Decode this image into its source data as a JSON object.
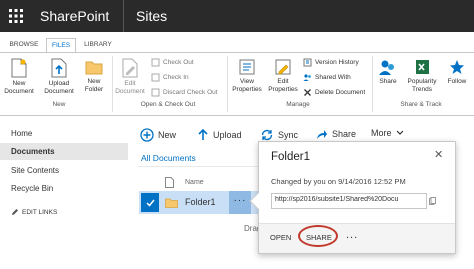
{
  "suite_bar": {
    "brand": "SharePoint",
    "site_link": "Sites",
    "bg_color": "#2a2a2a"
  },
  "ribbon": {
    "tabs": [
      {
        "label": "BROWSE",
        "selected": false
      },
      {
        "label": "FILES",
        "selected": true
      },
      {
        "label": "LIBRARY",
        "selected": false
      }
    ],
    "groups": {
      "new": {
        "label": "New",
        "new_document": "New Document",
        "upload_document": "Upload Document",
        "new_folder": "New Folder"
      },
      "open_checkout": {
        "label": "Open & Check Out",
        "edit_document": "Edit Document",
        "check_out": "Check Out",
        "check_in": "Check In",
        "discard_check_out": "Discard Check Out"
      },
      "manage": {
        "label": "Manage",
        "view_properties": "View Properties",
        "edit_properties": "Edit Properties",
        "version_history": "Version History",
        "shared_with": "Shared With",
        "delete_document": "Delete Document"
      },
      "share_track": {
        "label": "Share & Track",
        "share": "Share",
        "popularity_trends": "Popularity Trends",
        "follow": "Follow"
      }
    }
  },
  "left_nav": {
    "items": [
      "Home",
      "Documents",
      "Site Contents",
      "Recycle Bin"
    ],
    "edit_links": "EDIT LINKS"
  },
  "command_bar": {
    "new": "New",
    "upload": "Upload",
    "sync": "Sync",
    "share": "Share",
    "more": "More"
  },
  "list": {
    "view_name": "All Documents",
    "column_name": "Name",
    "rows": [
      {
        "name": "Folder1",
        "selected": true
      }
    ],
    "drag_hint": "Drag"
  },
  "callout": {
    "title": "Folder1",
    "changed_text": "Changed by you on 9/14/2016 12:52 PM",
    "url": "http://sp2016/subsite1/Shared%20Docu",
    "open_label": "OPEN",
    "share_label": "SHARE",
    "more_label": "..."
  },
  "colors": {
    "accent": "#0072c6",
    "selection": "#c9dff5",
    "highlight_ring": "#c0392b"
  },
  "icons": [
    "waffle-icon",
    "new-document-icon",
    "upload-document-icon",
    "new-folder-icon",
    "edit-document-icon",
    "check-out-icon",
    "check-in-icon",
    "discard-check-out-icon",
    "view-properties-icon",
    "edit-properties-icon",
    "version-history-icon",
    "shared-with-icon",
    "delete-icon",
    "share-icon",
    "popularity-trends-icon",
    "follow-icon",
    "plus-circle-icon",
    "upload-arrow-icon",
    "sync-icon",
    "share-arrow-icon",
    "chevron-down-icon",
    "pencil-icon",
    "document-icon",
    "folder-icon",
    "checkmark-icon",
    "close-icon",
    "copy-icon"
  ]
}
